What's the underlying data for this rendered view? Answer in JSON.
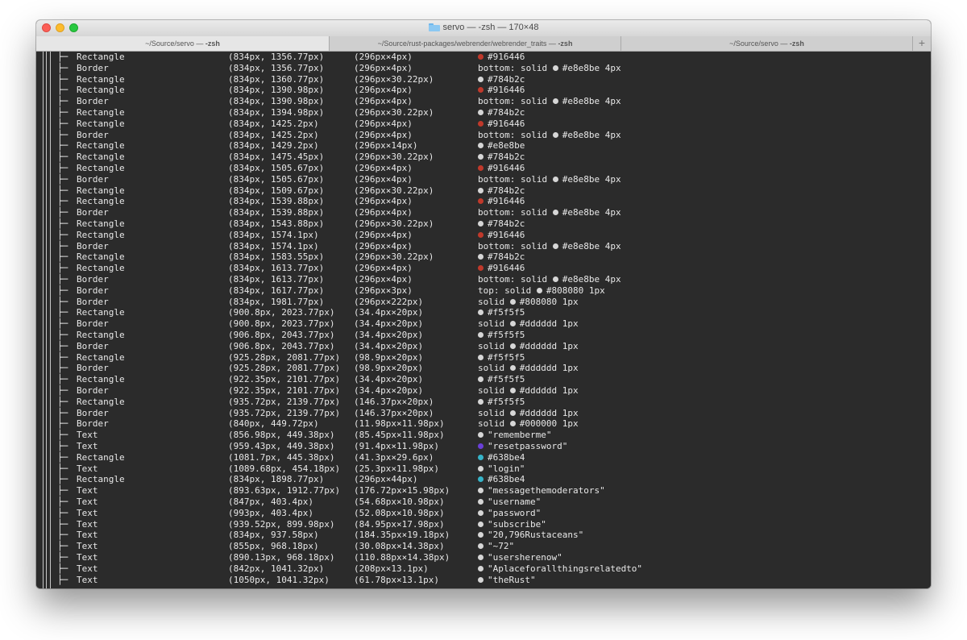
{
  "window": {
    "title": "servo — -zsh — 170×48",
    "folder_icon": "folder-icon"
  },
  "tabs": [
    {
      "path": "~/Source/servo — ",
      "cmd": "-zsh",
      "active": true
    },
    {
      "path": "~/Source/rust-packages/webrender/webrender_traits — ",
      "cmd": "-zsh",
      "active": false
    },
    {
      "path": "~/Source/servo — ",
      "cmd": "-zsh",
      "active": false
    }
  ],
  "new_tab_label": "+",
  "colors": {
    "red": "#c0392b",
    "gray": "#d6d6d6",
    "purple": "#6a3fd8",
    "cyan": "#36b4c9"
  },
  "rows": [
    {
      "type": "Rectangle",
      "pos": "(834px, 1356.77px)",
      "size": "(296px×4px)",
      "dot": "red",
      "val": "#916446"
    },
    {
      "type": "Border",
      "pos": "(834px, 1356.77px)",
      "size": "(296px×4px)",
      "pre": "bottom: solid",
      "dot": "gray",
      "val": "#e8e8be 4px"
    },
    {
      "type": "Rectangle",
      "pos": "(834px, 1360.77px)",
      "size": "(296px×30.22px)",
      "dot": "gray",
      "val": "#784b2c"
    },
    {
      "type": "Rectangle",
      "pos": "(834px, 1390.98px)",
      "size": "(296px×4px)",
      "dot": "red",
      "val": "#916446"
    },
    {
      "type": "Border",
      "pos": "(834px, 1390.98px)",
      "size": "(296px×4px)",
      "pre": "bottom: solid",
      "dot": "gray",
      "val": "#e8e8be 4px"
    },
    {
      "type": "Rectangle",
      "pos": "(834px, 1394.98px)",
      "size": "(296px×30.22px)",
      "dot": "gray",
      "val": "#784b2c"
    },
    {
      "type": "Rectangle",
      "pos": "(834px, 1425.2px)",
      "size": "(296px×4px)",
      "dot": "red",
      "val": "#916446"
    },
    {
      "type": "Border",
      "pos": "(834px, 1425.2px)",
      "size": "(296px×4px)",
      "pre": "bottom: solid",
      "dot": "gray",
      "val": "#e8e8be 4px"
    },
    {
      "type": "Rectangle",
      "pos": "(834px, 1429.2px)",
      "size": "(296px×14px)",
      "dot": "gray",
      "val": "#e8e8be"
    },
    {
      "type": "Rectangle",
      "pos": "(834px, 1475.45px)",
      "size": "(296px×30.22px)",
      "dot": "gray",
      "val": "#784b2c"
    },
    {
      "type": "Rectangle",
      "pos": "(834px, 1505.67px)",
      "size": "(296px×4px)",
      "dot": "red",
      "val": "#916446"
    },
    {
      "type": "Border",
      "pos": "(834px, 1505.67px)",
      "size": "(296px×4px)",
      "pre": "bottom: solid",
      "dot": "gray",
      "val": "#e8e8be 4px"
    },
    {
      "type": "Rectangle",
      "pos": "(834px, 1509.67px)",
      "size": "(296px×30.22px)",
      "dot": "gray",
      "val": "#784b2c"
    },
    {
      "type": "Rectangle",
      "pos": "(834px, 1539.88px)",
      "size": "(296px×4px)",
      "dot": "red",
      "val": "#916446"
    },
    {
      "type": "Border",
      "pos": "(834px, 1539.88px)",
      "size": "(296px×4px)",
      "pre": "bottom: solid",
      "dot": "gray",
      "val": "#e8e8be 4px"
    },
    {
      "type": "Rectangle",
      "pos": "(834px, 1543.88px)",
      "size": "(296px×30.22px)",
      "dot": "gray",
      "val": "#784b2c"
    },
    {
      "type": "Rectangle",
      "pos": "(834px, 1574.1px)",
      "size": "(296px×4px)",
      "dot": "red",
      "val": "#916446"
    },
    {
      "type": "Border",
      "pos": "(834px, 1574.1px)",
      "size": "(296px×4px)",
      "pre": "bottom: solid",
      "dot": "gray",
      "val": "#e8e8be 4px"
    },
    {
      "type": "Rectangle",
      "pos": "(834px, 1583.55px)",
      "size": "(296px×30.22px)",
      "dot": "gray",
      "val": "#784b2c"
    },
    {
      "type": "Rectangle",
      "pos": "(834px, 1613.77px)",
      "size": "(296px×4px)",
      "dot": "red",
      "val": "#916446"
    },
    {
      "type": "Border",
      "pos": "(834px, 1613.77px)",
      "size": "(296px×4px)",
      "pre": "bottom: solid",
      "dot": "gray",
      "val": "#e8e8be 4px"
    },
    {
      "type": "Border",
      "pos": "(834px, 1617.77px)",
      "size": "(296px×3px)",
      "pre": "top: solid",
      "dot": "gray",
      "val": "#808080 1px"
    },
    {
      "type": "Border",
      "pos": "(834px, 1981.77px)",
      "size": "(296px×222px)",
      "pre": "solid",
      "dot": "gray",
      "val": "#808080 1px"
    },
    {
      "type": "Rectangle",
      "pos": "(900.8px, 2023.77px)",
      "size": "(34.4px×20px)",
      "dot": "gray",
      "val": "#f5f5f5"
    },
    {
      "type": "Border",
      "pos": "(900.8px, 2023.77px)",
      "size": "(34.4px×20px)",
      "pre": "solid",
      "dot": "gray",
      "val": "#dddddd 1px"
    },
    {
      "type": "Rectangle",
      "pos": "(906.8px, 2043.77px)",
      "size": "(34.4px×20px)",
      "dot": "gray",
      "val": "#f5f5f5"
    },
    {
      "type": "Border",
      "pos": "(906.8px, 2043.77px)",
      "size": "(34.4px×20px)",
      "pre": "solid",
      "dot": "gray",
      "val": "#dddddd 1px"
    },
    {
      "type": "Rectangle",
      "pos": "(925.28px, 2081.77px)",
      "size": "(98.9px×20px)",
      "dot": "gray",
      "val": "#f5f5f5"
    },
    {
      "type": "Border",
      "pos": "(925.28px, 2081.77px)",
      "size": "(98.9px×20px)",
      "pre": "solid",
      "dot": "gray",
      "val": "#dddddd 1px"
    },
    {
      "type": "Rectangle",
      "pos": "(922.35px, 2101.77px)",
      "size": "(34.4px×20px)",
      "dot": "gray",
      "val": "#f5f5f5"
    },
    {
      "type": "Border",
      "pos": "(922.35px, 2101.77px)",
      "size": "(34.4px×20px)",
      "pre": "solid",
      "dot": "gray",
      "val": "#dddddd 1px"
    },
    {
      "type": "Rectangle",
      "pos": "(935.72px, 2139.77px)",
      "size": "(146.37px×20px)",
      "dot": "gray",
      "val": "#f5f5f5"
    },
    {
      "type": "Border",
      "pos": "(935.72px, 2139.77px)",
      "size": "(146.37px×20px)",
      "pre": "solid",
      "dot": "gray",
      "val": "#dddddd 1px"
    },
    {
      "type": "Border",
      "pos": "(840px, 449.72px)",
      "size": "(11.98px×11.98px)",
      "pre": "solid",
      "dot": "gray",
      "val": "#000000 1px"
    },
    {
      "type": "Text",
      "pos": "(856.98px, 449.38px)",
      "size": "(85.45px×11.98px)",
      "dot": "gray",
      "val": "\"rememberme\""
    },
    {
      "type": "Text",
      "pos": "(959.43px, 449.38px)",
      "size": "(91.4px×11.98px)",
      "dot": "purple",
      "val": "\"resetpassword\""
    },
    {
      "type": "Rectangle",
      "pos": "(1081.7px, 445.38px)",
      "size": "(41.3px×29.6px)",
      "dot": "cyan",
      "val": "#638be4"
    },
    {
      "type": "Text",
      "pos": "(1089.68px, 454.18px)",
      "size": "(25.3px×11.98px)",
      "dot": "gray",
      "val": "\"login\""
    },
    {
      "type": "Rectangle",
      "pos": "(834px, 1898.77px)",
      "size": "(296px×44px)",
      "dot": "cyan",
      "val": "#638be4"
    },
    {
      "type": "Text",
      "pos": "(893.63px, 1912.77px)",
      "size": "(176.72px×15.98px)",
      "dot": "gray",
      "val": "\"messagethemoderators\""
    },
    {
      "type": "Text",
      "pos": "(847px, 403.4px)",
      "size": "(54.68px×10.98px)",
      "dot": "gray",
      "val": "\"username\""
    },
    {
      "type": "Text",
      "pos": "(993px, 403.4px)",
      "size": "(52.08px×10.98px)",
      "dot": "gray",
      "val": "\"password\""
    },
    {
      "type": "Text",
      "pos": "(939.52px, 899.98px)",
      "size": "(84.95px×17.98px)",
      "dot": "gray",
      "val": "\"subscribe\""
    },
    {
      "type": "Text",
      "pos": "(834px, 937.58px)",
      "size": "(184.35px×19.18px)",
      "dot": "gray",
      "val": "\"20,796Rustaceans\""
    },
    {
      "type": "Text",
      "pos": "(855px, 968.18px)",
      "size": "(30.08px×14.38px)",
      "dot": "gray",
      "val": "\"~72\""
    },
    {
      "type": "Text",
      "pos": "(890.13px, 968.18px)",
      "size": "(110.88px×14.38px)",
      "dot": "gray",
      "val": "\"usersherenow\""
    },
    {
      "type": "Text",
      "pos": "(842px, 1041.32px)",
      "size": "(208px×13.1px)",
      "dot": "gray",
      "val": "\"Aplaceforallthingsrelatedto\""
    },
    {
      "type": "Text",
      "pos": "(1050px, 1041.32px)",
      "size": "(61.78px×13.1px)",
      "dot": "gray",
      "val": "\"theRust\""
    }
  ]
}
